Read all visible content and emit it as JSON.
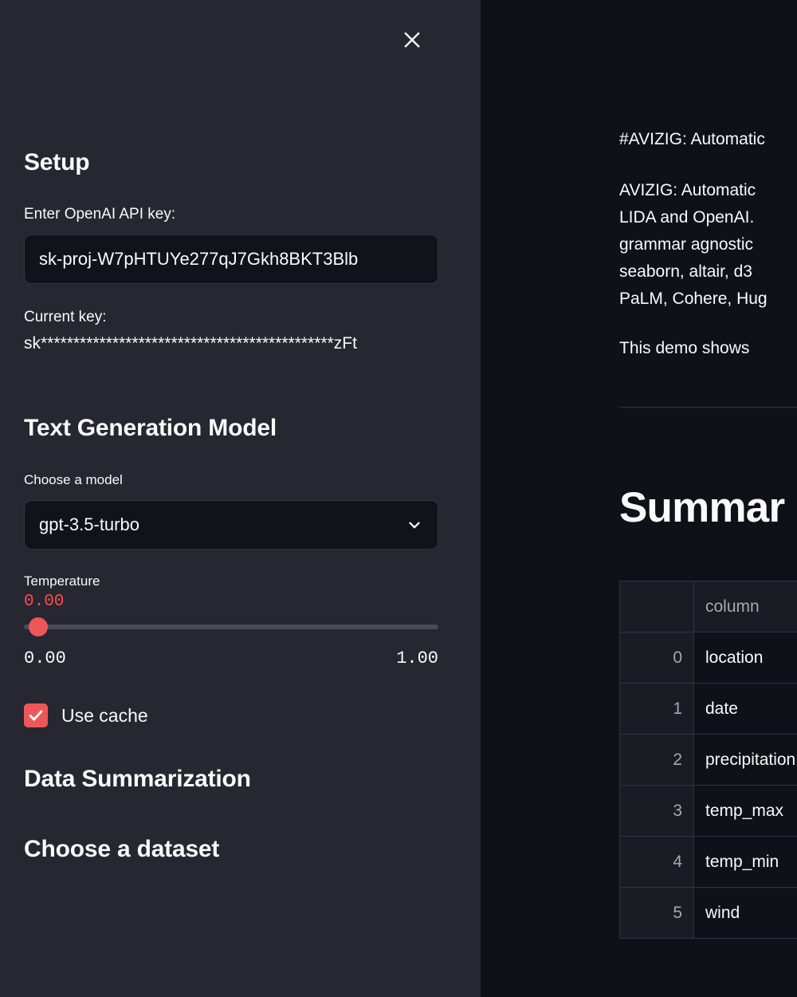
{
  "theme": {
    "sidebar_bg": "#262730",
    "main_bg": "#0e1117",
    "accent": "#ee5757",
    "accent_text": "#ff4b4b",
    "border": "#31333f",
    "text": "#fafafa",
    "muted_text": "#a3a8b8"
  },
  "sidebar": {
    "close_icon": "close-icon",
    "setup": {
      "heading": "Setup",
      "api_key_label": "Enter OpenAI API key:",
      "api_key_value": "sk-proj-W7pHTUYe277qJ7Gkh8BKT3Blb",
      "api_key_placeholder": "",
      "current_key_label": "Current key:",
      "current_key_masked": "sk*********************************************zFt"
    },
    "text_generation_model": {
      "heading": "Text Generation Model",
      "model_label": "Choose a model",
      "model_value": "gpt-3.5-turbo",
      "model_chevron_icon": "chevron-down-icon",
      "temperature_label": "Temperature",
      "temperature_value": "0.00",
      "temperature_min": "0.00",
      "temperature_max": "1.00",
      "temperature_fill_percent": 0,
      "use_cache_label": "Use cache",
      "use_cache_checked": true,
      "check_icon": "check-icon"
    },
    "data_summarization": {
      "heading": "Data Summarization",
      "dataset_label": "Choose a dataset"
    }
  },
  "main": {
    "intro_lines": [
      "#AVIZIG: Automatic",
      "AVIZIG: Automatic",
      "LIDA and OpenAI. ",
      "grammar agnostic",
      "seaborn, altair, d3",
      "PaLM, Cohere, Hug",
      "This demo shows"
    ],
    "summary_title": "Summar",
    "table": {
      "headers": [
        "",
        "column"
      ],
      "rows": [
        {
          "index": "0",
          "column": "location"
        },
        {
          "index": "1",
          "column": "date"
        },
        {
          "index": "2",
          "column": "precipitation"
        },
        {
          "index": "3",
          "column": "temp_max"
        },
        {
          "index": "4",
          "column": "temp_min"
        },
        {
          "index": "5",
          "column": "wind"
        }
      ]
    }
  }
}
